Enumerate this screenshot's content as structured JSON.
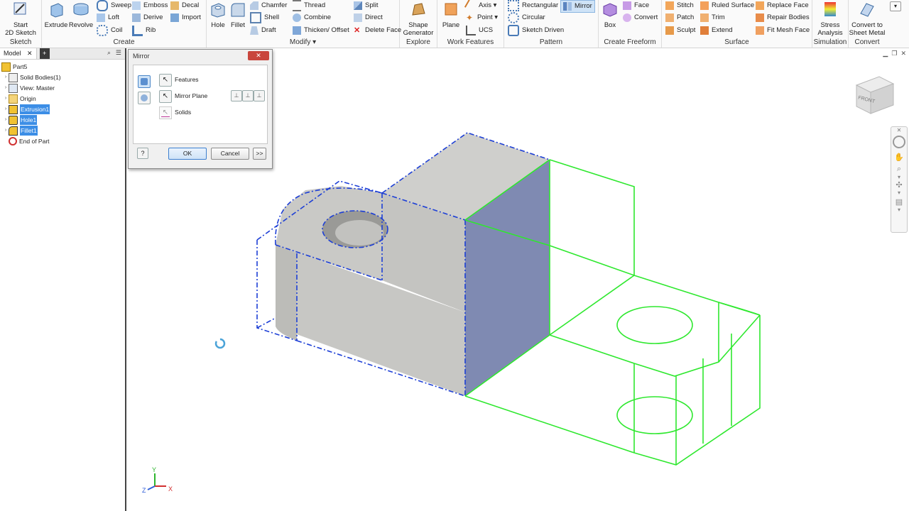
{
  "ribbon": {
    "sketch": {
      "start_sketch": "Start\n2D Sketch",
      "group_label": "Sketch"
    },
    "create": {
      "extrude": "Extrude",
      "revolve": "Revolve",
      "sweep": "Sweep",
      "loft": "Loft",
      "coil": "Coil",
      "emboss": "Emboss",
      "derive": "Derive",
      "rib": "Rib",
      "decal": "Decal",
      "import": "Import",
      "group_label": "Create"
    },
    "modify": {
      "hole": "Hole",
      "fillet": "Fillet",
      "chamfer": "Chamfer",
      "shell": "Shell",
      "draft": "Draft",
      "thread": "Thread",
      "combine": "Combine",
      "thicken": "Thicken/ Offset",
      "split": "Split",
      "direct": "Direct",
      "delete_face": "Delete Face",
      "group_label": "Modify ▾"
    },
    "explore": {
      "shape_generator": "Shape\nGenerator",
      "group_label": "Explore"
    },
    "work_features": {
      "plane": "Plane",
      "axis": "Axis ▾",
      "point": "Point ▾",
      "ucs": "UCS",
      "group_label": "Work Features"
    },
    "pattern": {
      "rectangular": "Rectangular",
      "circular": "Circular",
      "sketch_driven": "Sketch Driven",
      "mirror": "Mirror",
      "group_label": "Pattern"
    },
    "freeform": {
      "box": "Box",
      "face": "Face",
      "convert": "Convert",
      "group_label": "Create Freeform"
    },
    "surface": {
      "stitch": "Stitch",
      "patch": "Patch",
      "sculpt": "Sculpt",
      "ruled_surface": "Ruled Surface",
      "trim": "Trim",
      "extend": "Extend",
      "replace_face": "Replace Face",
      "repair_bodies": "Repair Bodies",
      "fit_mesh_face": "Fit Mesh Face",
      "group_label": "Surface"
    },
    "simulation": {
      "stress": "Stress\nAnalysis",
      "group_label": "Simulation"
    },
    "convert": {
      "sheet_metal": "Convert to\nSheet Metal",
      "group_label": "Convert"
    }
  },
  "browser": {
    "tab": "Model",
    "tree": [
      {
        "label": "Part5"
      },
      {
        "label": "Solid Bodies(1)"
      },
      {
        "label": "View: Master"
      },
      {
        "label": "Origin"
      },
      {
        "label": "Extrusion1"
      },
      {
        "label": "Hole1"
      },
      {
        "label": "Fillet1"
      },
      {
        "label": "End of Part"
      }
    ]
  },
  "dialog": {
    "title": "Mirror",
    "features": "Features",
    "mirror_plane": "Mirror Plane",
    "solids": "Solids",
    "ok": "OK",
    "cancel": "Cancel",
    "more": ">>"
  },
  "viewcube": {
    "face": "FRONT"
  },
  "triad": {
    "x": "X",
    "y": "Y",
    "z": "Z"
  },
  "colors": {
    "selection_blue": "#1d3fd6",
    "preview_green": "#2ee82e",
    "highlight": "#3c8ee6",
    "face_gray": "#c8c8c6",
    "mirror_face": "#7f8ab2"
  }
}
